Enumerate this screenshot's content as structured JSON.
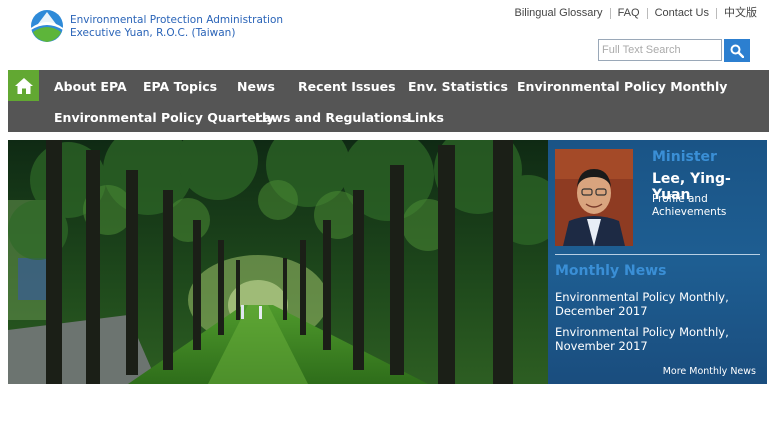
{
  "header": {
    "org_line1": "Environmental Protection Administration",
    "org_line2": "Executive Yuan, R.O.C. (Taiwan)",
    "top_links": [
      "Bilingual Glossary",
      "FAQ",
      "Contact Us",
      "中文版"
    ],
    "search_placeholder": "Full Text Search"
  },
  "nav": {
    "home_icon": "home-icon",
    "row1": [
      "About EPA",
      "EPA Topics",
      "News",
      "Recent Issues",
      "Env. Statistics",
      "Environmental Policy Monthly"
    ],
    "row2": [
      "Environmental Policy Quarterly",
      "Laws and Regulations",
      "Links"
    ]
  },
  "sidebar": {
    "minister_label": "Minister",
    "minister_name": "Lee, Ying-Yuan",
    "profile_link_line1": "Profile and",
    "profile_link_line2": "Achievements",
    "news_label": "Monthly News",
    "news_items": [
      {
        "line1": "Environmental Policy Monthly,",
        "line2": "December 2017"
      },
      {
        "line1": "Environmental Policy Monthly,",
        "line2": "November 2017"
      }
    ],
    "more_link": "More Monthly News"
  },
  "colors": {
    "nav_bg": "#555555",
    "home_green": "#62a832",
    "brand_blue": "#2a64b8",
    "sidebar_blue": "#1f5a8c",
    "search_button": "#2c7fd0"
  }
}
